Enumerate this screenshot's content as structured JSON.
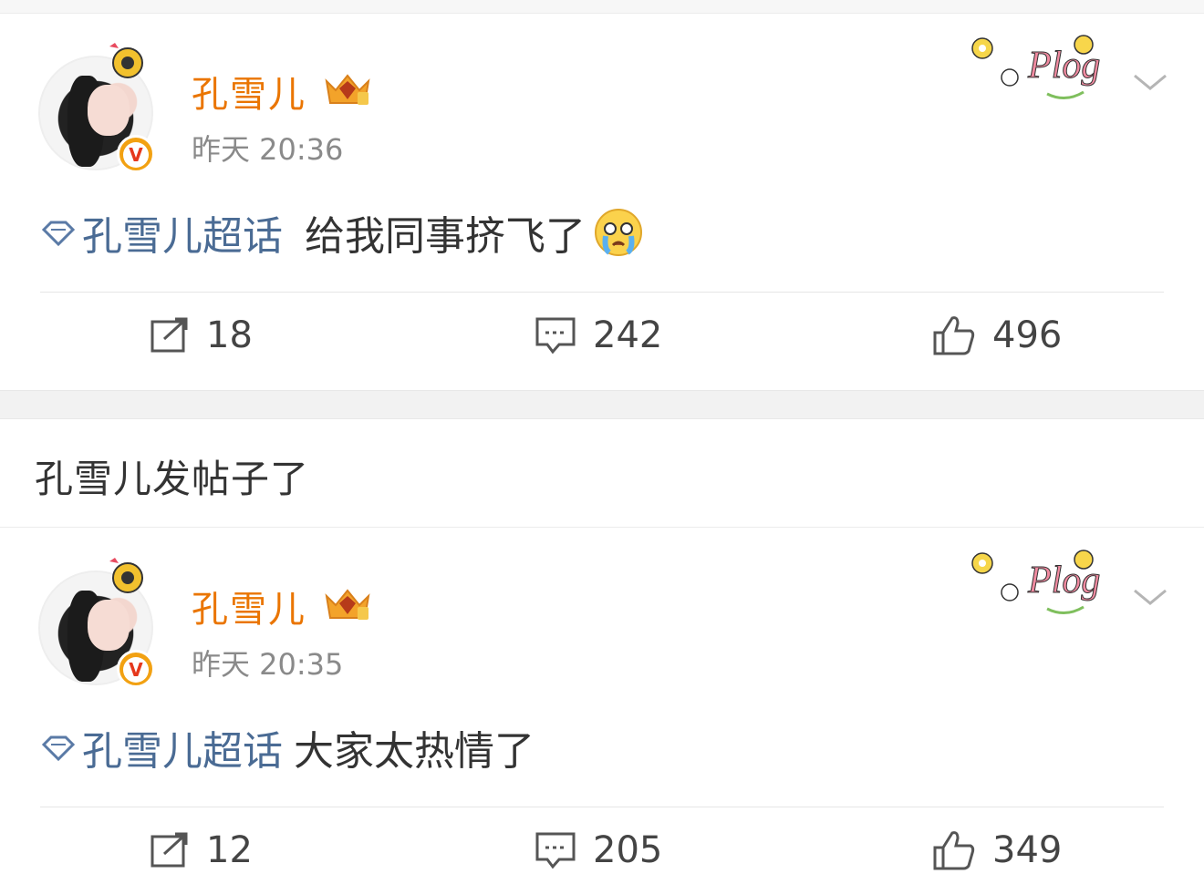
{
  "posts": [
    {
      "username": "孔雪儿",
      "time": "昨天 20:36",
      "topic": "孔雪儿超话",
      "text": "给我同事挤飞了",
      "emoji": "crying-emoji",
      "sticker": "Plog",
      "actions": {
        "share": "18",
        "comment": "242",
        "like": "496"
      }
    },
    {
      "username": "孔雪儿",
      "time": "昨天 20:35",
      "topic": "孔雪儿超话",
      "text": "大家太热情了",
      "sticker": "Plog",
      "actions": {
        "share": "12",
        "comment": "205",
        "like": "349"
      }
    }
  ],
  "section_header": "孔雪儿发帖子了",
  "badge_letter": "V",
  "colors": {
    "username": "#ea7500",
    "topic": "#4a6b94",
    "time": "#8a8a8a",
    "badge": "#f2a112"
  },
  "icons": [
    "topic-diamond-icon",
    "share-icon",
    "comment-icon",
    "like-icon",
    "chevron-down-icon",
    "crown-badge-icon"
  ]
}
